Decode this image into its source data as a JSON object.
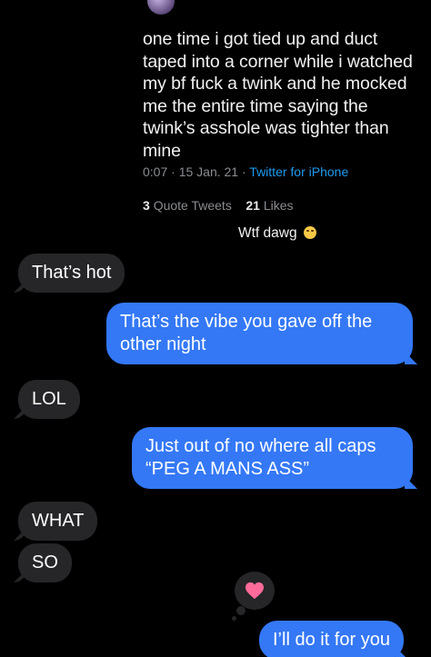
{
  "tweet": {
    "text": "one time i got tied up and duct taped into a corner while i watched my bf fuck a twink and he mocked me the entire time saying the twink’s asshole was tighter than mine",
    "time": "0:07",
    "date": "15 Jan. 21",
    "source": "Twitter for iPhone",
    "quote_tweets_count": "3",
    "quote_tweets_label": "Quote Tweets",
    "likes_count": "21",
    "likes_label": "Likes"
  },
  "caption": {
    "text": "Wtf dawg",
    "emoji": "laughing-emoji"
  },
  "messages": [
    {
      "direction": "in",
      "text": "That’s hot"
    },
    {
      "direction": "out",
      "text": "That’s the vibe you gave off the other night"
    },
    {
      "direction": "in",
      "text": "LOL"
    },
    {
      "direction": "out",
      "text": "Just out of no where all caps “PEG A MANS ASS”"
    },
    {
      "direction": "in",
      "text": "WHAT"
    },
    {
      "direction": "in",
      "text": "SO"
    },
    {
      "direction": "out",
      "text": "I’ll do it for you"
    }
  ],
  "tapback": {
    "icon": "heart-icon",
    "color": "#ff6b9a"
  },
  "colors": {
    "background": "#000000",
    "incoming_bubble": "#262628",
    "outgoing_bubble": "#3478f6",
    "link": "#1d9bf0"
  }
}
